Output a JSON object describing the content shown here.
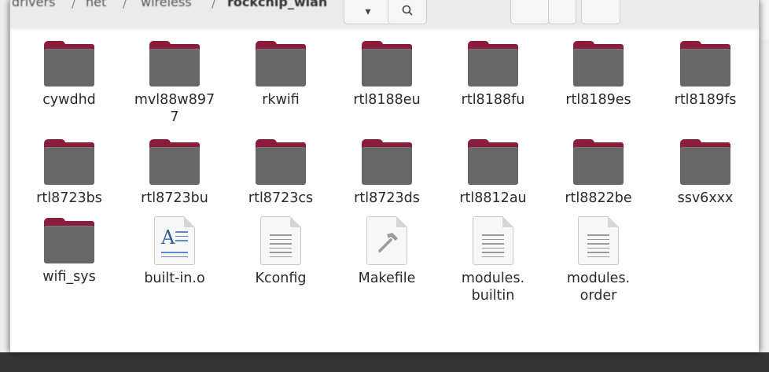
{
  "window": {
    "breadcrumb": [
      "drivers",
      "net",
      "wireless",
      "rockchip_wlan"
    ],
    "buttons": {
      "dropdown": "▾",
      "search": "🔍"
    }
  },
  "files": [
    {
      "name": "cywdhd",
      "type": "folder"
    },
    {
      "name": "mvl88w8977",
      "type": "folder"
    },
    {
      "name": "rkwifi",
      "type": "folder"
    },
    {
      "name": "rtl8188eu",
      "type": "folder"
    },
    {
      "name": "rtl8188fu",
      "type": "folder"
    },
    {
      "name": "rtl8189es",
      "type": "folder"
    },
    {
      "name": "rtl8189fs",
      "type": "folder"
    },
    {
      "name": "rtl8723bs",
      "type": "folder"
    },
    {
      "name": "rtl8723bu",
      "type": "folder"
    },
    {
      "name": "rtl8723cs",
      "type": "folder"
    },
    {
      "name": "rtl8723ds",
      "type": "folder"
    },
    {
      "name": "rtl8812au",
      "type": "folder"
    },
    {
      "name": "rtl8822be",
      "type": "folder"
    },
    {
      "name": "ssv6xxx",
      "type": "folder"
    },
    {
      "name": "wifi_sys",
      "type": "folder"
    },
    {
      "name": "built-in.o",
      "type": "object-file"
    },
    {
      "name": "Kconfig",
      "type": "text-file"
    },
    {
      "name": "Makefile",
      "type": "makefile"
    },
    {
      "name": "modules.builtin",
      "type": "text-file"
    },
    {
      "name": "modules.order",
      "type": "text-file"
    }
  ],
  "colors": {
    "folder_tab": "#8b1d3c",
    "folder_body": "#676767",
    "label_text": "#2a2a2a"
  }
}
